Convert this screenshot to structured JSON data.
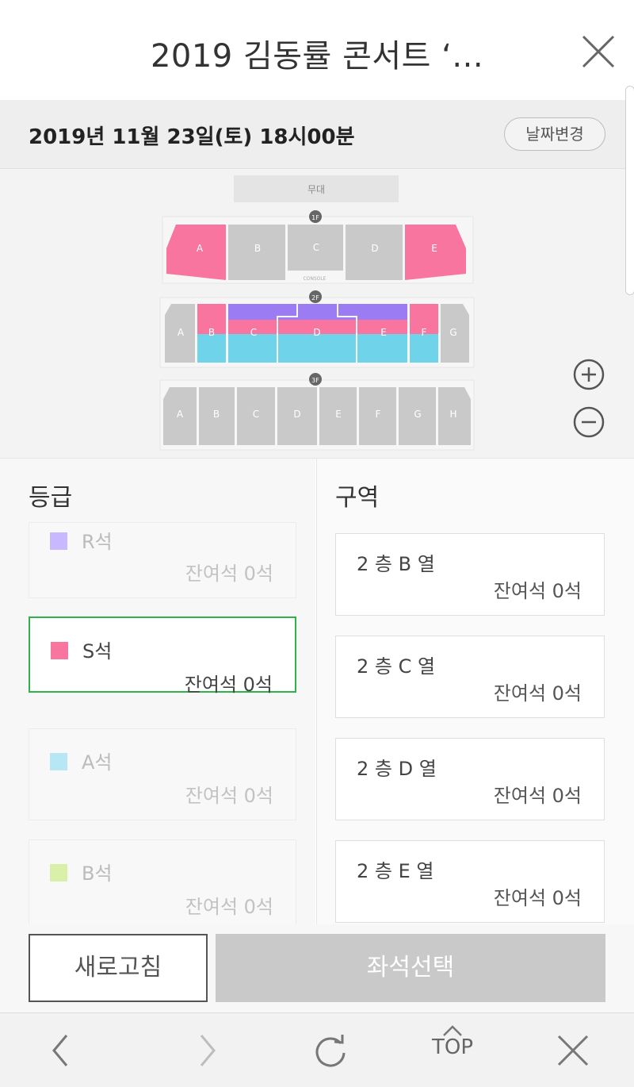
{
  "header": {
    "title": "2019 김동률 콘서트 ‘..."
  },
  "date_bar": {
    "date": "2019년 11월 23일(토) 18시00분",
    "change_label": "날짜변경"
  },
  "seat_map": {
    "stage_label": "무대",
    "console_label": "CONSOLE",
    "floors": [
      {
        "label": "1F",
        "sections": [
          "A",
          "B",
          "C",
          "D",
          "E"
        ]
      },
      {
        "label": "2F",
        "sections": [
          "A",
          "B",
          "C",
          "D",
          "E",
          "F",
          "G"
        ]
      },
      {
        "label": "3F",
        "sections": [
          "A",
          "B",
          "C",
          "D",
          "E",
          "F",
          "G",
          "H"
        ]
      }
    ]
  },
  "grades": {
    "title": "등급",
    "items": [
      {
        "name": "R석",
        "remaining": "잔여석 0석",
        "color": "#c7b8ff"
      },
      {
        "name": "S석",
        "remaining": "잔여석 0석",
        "color": "#f7759e",
        "selected": true
      },
      {
        "name": "A석",
        "remaining": "잔여석 0석",
        "color": "#b7e6f5"
      },
      {
        "name": "B석",
        "remaining": "잔여석 0석",
        "color": "#d8f0a8"
      }
    ]
  },
  "zones": {
    "title": "구역",
    "items": [
      {
        "name": "2 층 B 열",
        "remaining": "잔여석 0석"
      },
      {
        "name": "2 층 C 열",
        "remaining": "잔여석 0석"
      },
      {
        "name": "2 층 D 열",
        "remaining": "잔여석 0석"
      },
      {
        "name": "2 층 E 열",
        "remaining": "잔여석 0석"
      }
    ]
  },
  "actions": {
    "refresh_label": "새로고침",
    "select_label": "좌석선택"
  },
  "browser_nav": {
    "top_label": "TOP"
  },
  "colors": {
    "pink": "#f7759e",
    "purple": "#9b7cf2",
    "cyan": "#6fd3ea",
    "gray": "#c9c9c9",
    "selected_border": "#2fb24a"
  }
}
